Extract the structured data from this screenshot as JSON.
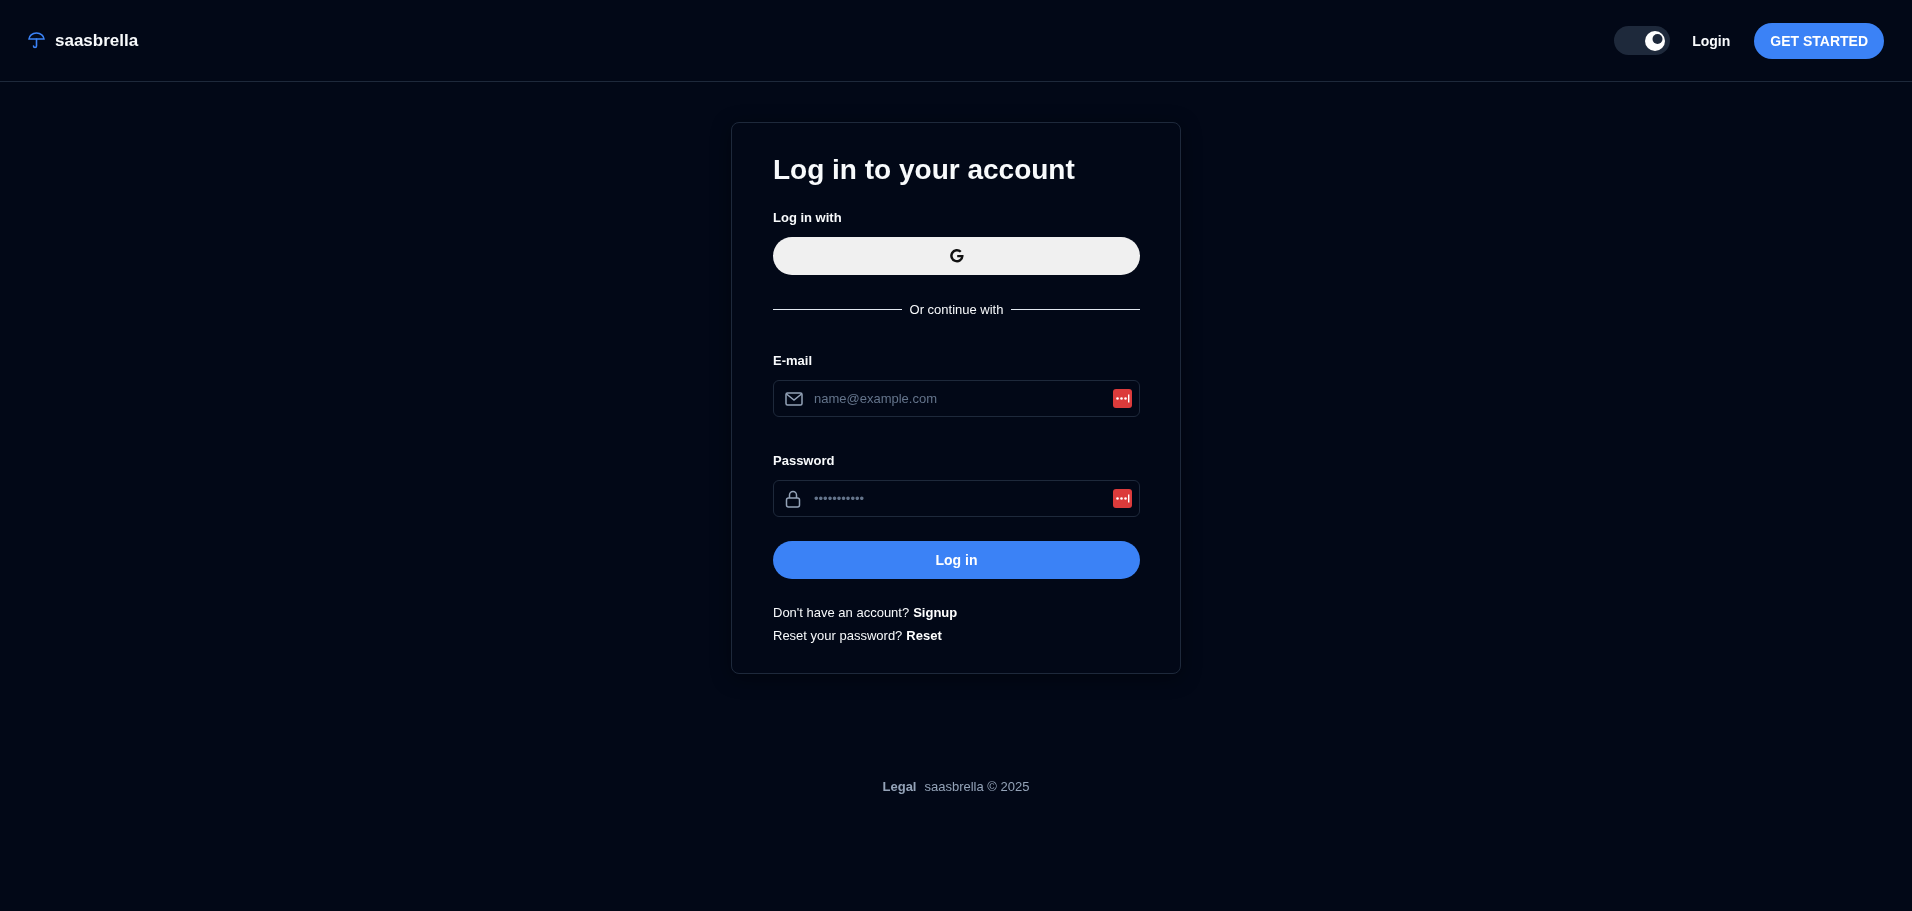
{
  "header": {
    "brand": "saasbrella",
    "theme_toggle": {
      "on": true
    },
    "login_link": "Login",
    "cta": "GET STARTED"
  },
  "card": {
    "title": "Log in to your account",
    "social_label": "Log in with",
    "divider_text": "Or continue with",
    "fields": [
      {
        "kind": "email",
        "label": "E-mail",
        "placeholder": "name@example.com"
      },
      {
        "kind": "password",
        "label": "Password",
        "placeholder": "•••••••••••"
      }
    ],
    "submit": "Log in",
    "links": [
      {
        "text": "Don't have an account?",
        "link": "Signup"
      },
      {
        "text": "Reset your password?",
        "link": "Reset"
      }
    ]
  },
  "footer": {
    "legal": "Legal",
    "copyright": "saasbrella © 2025"
  }
}
